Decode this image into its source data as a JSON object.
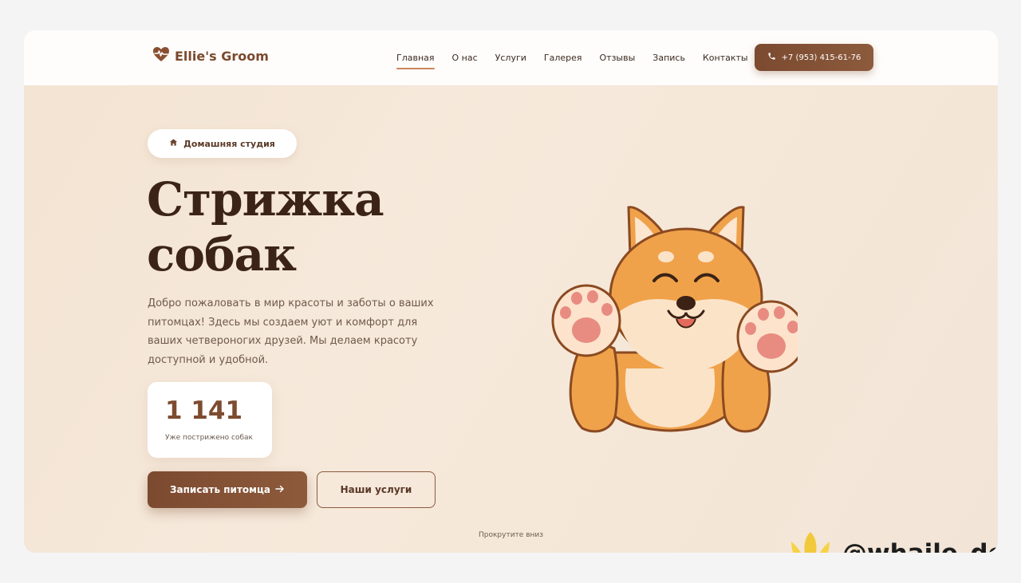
{
  "header": {
    "logo_text": "Ellie's Groom",
    "nav": [
      {
        "label": "Главная",
        "active": true
      },
      {
        "label": "О нас"
      },
      {
        "label": "Услуги"
      },
      {
        "label": "Галерея"
      },
      {
        "label": "Отзывы"
      },
      {
        "label": "Запись"
      },
      {
        "label": "Контакты"
      }
    ],
    "phone": "+7 (953) 415-61-76"
  },
  "hero": {
    "badge": "Домашняя студия",
    "title_line1": "Стрижка",
    "title_line2": "собак",
    "description": "Добро пожаловать в мир красоты и заботы о ваших питомцах! Здесь мы создаем уют и комфорт для ваших четвероногих друзей. Мы делаем красоту доступной и удобной.",
    "stat_value": "1 141",
    "stat_label": "Уже пострижено собак",
    "primary_button": "Записать питомца",
    "secondary_button": "Наши услуги",
    "scroll_hint": "Прокрутите вниз"
  },
  "watermark": {
    "text": "@whaile_dev"
  },
  "colors": {
    "accent": "#7b4a30",
    "title": "#3b2417",
    "background": "#f5e7d7"
  },
  "icons": [
    "heart-pulse-icon",
    "phone-icon",
    "home-icon",
    "arrow-right-icon",
    "tulip-logo-icon",
    "shiba-dog-illustration"
  ]
}
